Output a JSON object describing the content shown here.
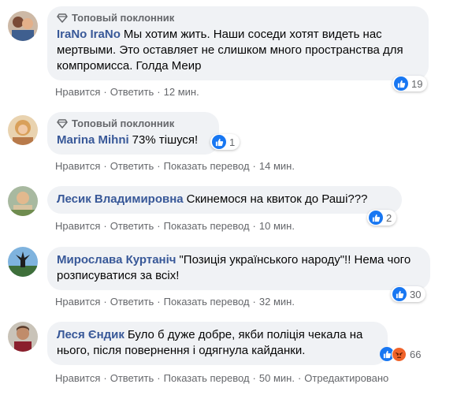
{
  "comments": [
    {
      "badge": "Топовый поклонник",
      "author": "IraNo IraNo",
      "text": "Мы хотим жить. Наши соседи хотят видеть нас мертвыми. Это оставляет не слишком много пространства для компромисса. Голда Меир",
      "reactions_count": "19",
      "like_label": "Нравится",
      "reply_label": "Ответить",
      "time": "12 мин."
    },
    {
      "badge": "Топовый поклонник",
      "author": "Marina Mihni",
      "text": "73% тішуся!",
      "reactions_count": "1",
      "like_label": "Нравится",
      "reply_label": "Ответить",
      "translate_label": "Показать перевод",
      "time": "14 мин."
    },
    {
      "author": "Лесик Владимировна",
      "text": "Скинемося на квиток до Раші???",
      "reactions_count": "2",
      "like_label": "Нравится",
      "reply_label": "Ответить",
      "translate_label": "Показать перевод",
      "time": "10 мин."
    },
    {
      "author": "Мирослава Куртаніч",
      "text": "\"Позиція українського народу\"!! Нема чого розписуватися за всіх!",
      "reactions_count": "30",
      "like_label": "Нравится",
      "reply_label": "Ответить",
      "translate_label": "Показать перевод",
      "time": "32 мин."
    },
    {
      "author": "Леся Єндик",
      "text": "Було б дуже добре, якби поліція чекала на нього, після повернення і одягнула кайданки.",
      "reactions_count": "66",
      "like_label": "Нравится",
      "reply_label": "Ответить",
      "translate_label": "Показать перевод",
      "time": "50 мин.",
      "edited_label": "Отредактировано"
    }
  ],
  "colors": {
    "author": "#385898",
    "bubble": "#f0f2f5",
    "meta": "#65676b",
    "like": "#1877f2",
    "angry": "#f0632a"
  },
  "icons": {
    "badge": "diamond-icon",
    "like": "thumbs-up-icon",
    "angry": "angry-face-icon"
  }
}
